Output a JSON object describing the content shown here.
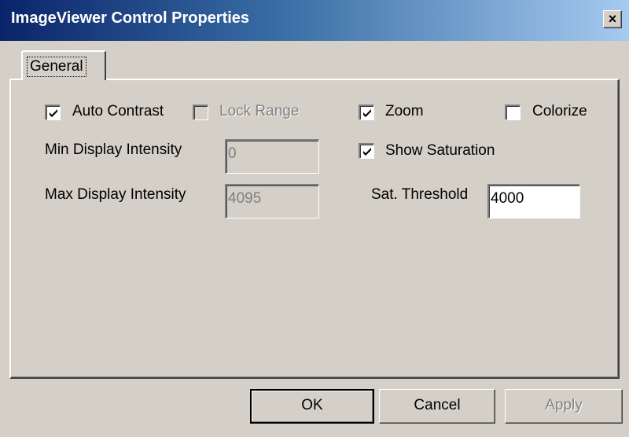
{
  "window": {
    "title": "ImageViewer Control Properties",
    "close_label": "×"
  },
  "tabs": [
    {
      "label": "General"
    }
  ],
  "general": {
    "auto_contrast": {
      "label": "Auto Contrast",
      "checked": true
    },
    "lock_range": {
      "label": "Lock Range",
      "checked": false,
      "disabled": true
    },
    "zoom": {
      "label": "Zoom",
      "checked": true
    },
    "colorize": {
      "label": "Colorize",
      "checked": false
    },
    "show_saturation": {
      "label": "Show Saturation",
      "checked": true
    },
    "min_display_intensity": {
      "label": "Min Display Intensity",
      "value": "0",
      "disabled": true
    },
    "max_display_intensity": {
      "label": "Max Display Intensity",
      "value": "4095",
      "disabled": true
    },
    "sat_threshold": {
      "label": "Sat. Threshold",
      "value": "4000"
    }
  },
  "buttons": {
    "ok": "OK",
    "cancel": "Cancel",
    "apply": "Apply"
  }
}
